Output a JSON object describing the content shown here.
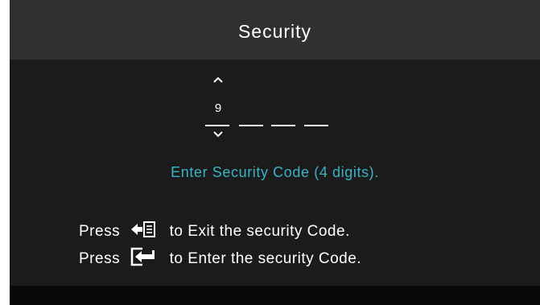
{
  "header": {
    "title": "Security"
  },
  "code_entry": {
    "digits": [
      "9",
      "",
      "",
      ""
    ],
    "active_index": 0,
    "up_icon": "chevron-up-icon",
    "down_icon": "chevron-down-icon"
  },
  "prompt": "Enter Security Code (4 digits).",
  "instructions": [
    {
      "prefix": "Press",
      "icon": "exit-key-icon",
      "text": "to Exit the security Code."
    },
    {
      "prefix": "Press",
      "icon": "enter-key-icon",
      "text": "to Enter the security Code."
    }
  ],
  "colors": {
    "accent": "#3ab3c6",
    "header_bg": "#303030",
    "body_bg": "#1b1b1b"
  }
}
